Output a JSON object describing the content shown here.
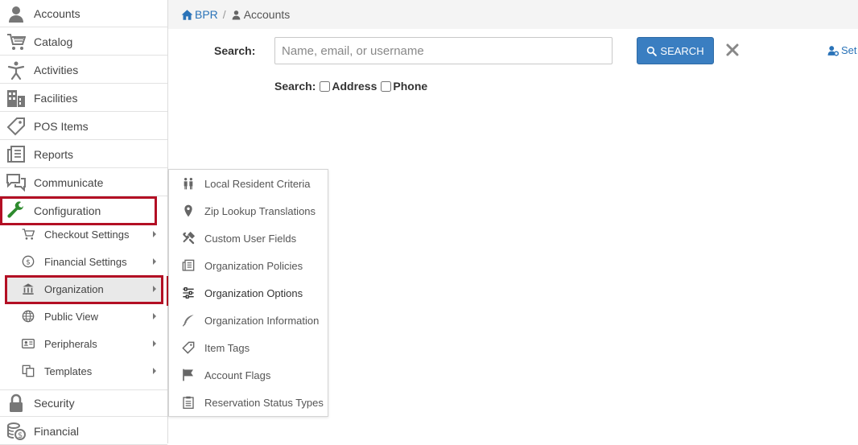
{
  "breadcrumb": {
    "home": "BPR",
    "separator": "/",
    "current": "Accounts"
  },
  "sidebar": {
    "items": [
      {
        "label": "Accounts",
        "icon": "person-icon"
      },
      {
        "label": "Catalog",
        "icon": "cart-icon"
      },
      {
        "label": "Activities",
        "icon": "activity-person-icon"
      },
      {
        "label": "Facilities",
        "icon": "building-icon"
      },
      {
        "label": "POS Items",
        "icon": "tag-icon"
      },
      {
        "label": "Reports",
        "icon": "reports-icon"
      },
      {
        "label": "Communicate",
        "icon": "chat-icon"
      },
      {
        "label": "Configuration",
        "icon": "wrench-icon"
      },
      {
        "label": "Security",
        "icon": "lock-icon"
      },
      {
        "label": "Financial",
        "icon": "coins-icon"
      }
    ],
    "config_sub": [
      {
        "label": "Checkout Settings",
        "icon": "cart-icon"
      },
      {
        "label": "Financial Settings",
        "icon": "dollar-circle-icon"
      },
      {
        "label": "Organization",
        "icon": "bank-icon"
      },
      {
        "label": "Public View",
        "icon": "globe-icon"
      },
      {
        "label": "Peripherals",
        "icon": "id-card-icon"
      },
      {
        "label": "Templates",
        "icon": "copy-icon"
      }
    ]
  },
  "search": {
    "label": "Search:",
    "placeholder": "Name, email, or username",
    "button_label": "SEARCH",
    "options_label": "Search:",
    "option_address": "Address",
    "option_phone": "Phone",
    "set_link": "Set"
  },
  "flyout": {
    "items": [
      {
        "label": "Local Resident Criteria",
        "icon": "people-icon"
      },
      {
        "label": "Zip Lookup Translations",
        "icon": "map-pin-icon"
      },
      {
        "label": "Custom User Fields",
        "icon": "tools-icon"
      },
      {
        "label": "Organization Policies",
        "icon": "policies-icon"
      },
      {
        "label": "Organization Options",
        "icon": "sliders-icon"
      },
      {
        "label": "Organization Information",
        "icon": "feather-icon"
      },
      {
        "label": "Item Tags",
        "icon": "tag-icon"
      },
      {
        "label": "Account Flags",
        "icon": "flag-icon"
      },
      {
        "label": "Reservation Status Types",
        "icon": "clipboard-icon"
      }
    ]
  },
  "colors": {
    "accent": "#3a7ec1",
    "highlight": "#b30f24",
    "wrench": "#2e8b2e"
  }
}
